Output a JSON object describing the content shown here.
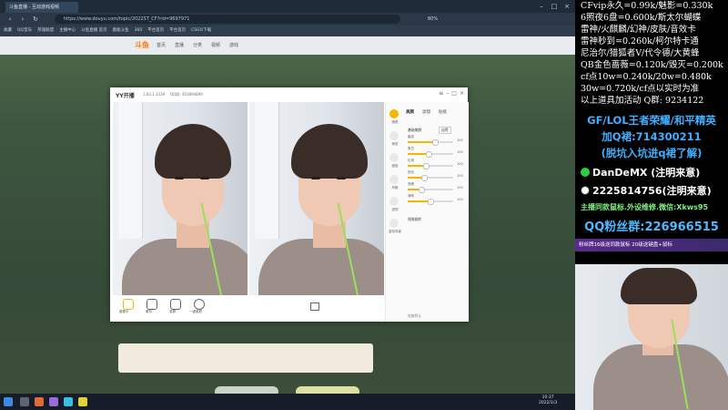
{
  "browser": {
    "tab_title": "斗鱼直播 - 互动游戏视频",
    "url": "https://www.douyu.com/topic/2022ST_CF?rid=9697971",
    "zoom": "80%",
    "bookmarks": [
      "收藏",
      "QQ音乐",
      "英雄联盟",
      "主播中心",
      "斗鱼直播 首页",
      "鹿鹿斗鱼",
      "360",
      "平台首页",
      "平台首页",
      "CSGO下载"
    ]
  },
  "site": {
    "logo": "斗鱼",
    "nav": [
      "首页",
      "直播",
      "分类",
      "视频",
      "游戏"
    ]
  },
  "yy": {
    "logo": "YY开播",
    "version": "1.83.1.3339",
    "qq_id": "QQ群: 403894899",
    "tabs": [
      "美颜",
      "滤镜",
      "贴纸"
    ],
    "side_icons": [
      "美颜",
      "美型",
      "瘦脸",
      "风格",
      "滤镜",
      "虚拟背景"
    ],
    "beauty_toggle": "基础美颜",
    "preset": "自然",
    "sliders": [
      {
        "label": "磨皮",
        "value": 60,
        "max_label": "100"
      },
      {
        "label": "美白",
        "value": 45,
        "max_label": "100"
      },
      {
        "label": "红润",
        "value": 40,
        "max_label": "100"
      },
      {
        "label": "锐化",
        "value": 35,
        "max_label": "100"
      },
      {
        "label": "亮眼",
        "value": 30,
        "max_label": "100"
      },
      {
        "label": "清晰",
        "value": 50,
        "max_label": "100"
      }
    ],
    "mirror": "镜像翻转",
    "bottom_tools": [
      "摄像头",
      "素材",
      "录屏",
      "一键美颜"
    ],
    "bottom_link": "恢复默认"
  },
  "taskbar": {
    "time": "10:37",
    "date": "2022/1/3"
  },
  "overlay": {
    "price_lines": [
      "CFvip永久=0.99k/魅影=0.330k",
      "6照夜6盘=0.600k/斯太尔蝴蝶",
      "雷神/火麒麟/幻神/皮肤/音效卡",
      "雷神秒到=0.260k/柯尔特卡通",
      "尼治尔/猎狐者V/代令德/大黄蜂",
      "QB金色蔷薇=0.120k/毁灭=0.200k",
      "cf点10w=0.240k/20w=0.480k",
      "30w=0.720k/cf点以实时为准",
      "以上道具加活动 Q群: 9234122"
    ],
    "promo_1": "GF/LOL王者荣耀/和平精英",
    "promo_2": "加Q裙:714300211",
    "promo_3": "(脱坑入坑进q裙了解)",
    "wechat": "DanDeMX (注明来意)",
    "qq": "2225814756(注明来意)",
    "notice": "主播同款鼠标.外设维修.微信:Xkws95",
    "fans_group": "QQ粉丝群:226966515",
    "banner": "粉丝牌16级送同款鼠标 20级送键盘+鼠标"
  }
}
